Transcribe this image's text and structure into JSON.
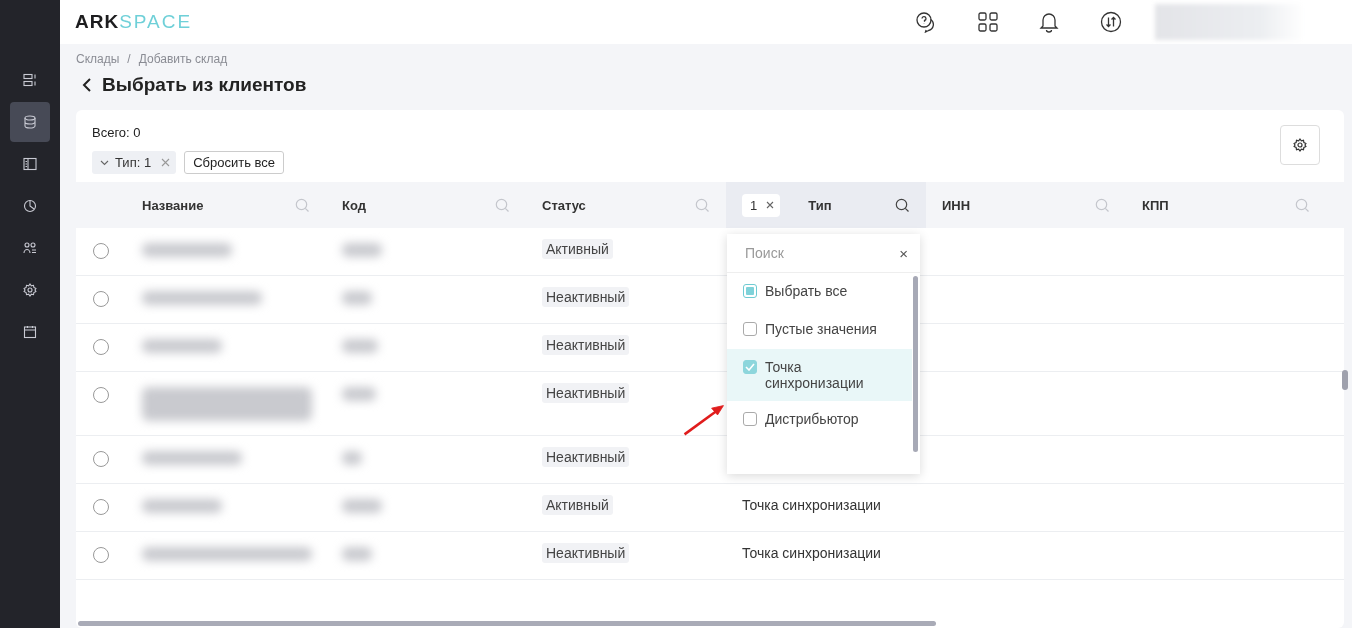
{
  "logo": {
    "dark": "ARK",
    "light": "SPACE"
  },
  "sidebar": {
    "items": [
      {
        "selected": false
      },
      {
        "selected": true
      },
      {
        "selected": false
      },
      {
        "selected": false
      },
      {
        "selected": false
      },
      {
        "selected": false
      },
      {
        "selected": false
      }
    ]
  },
  "breadcrumbs": [
    "Склады",
    "/",
    "Добавить склад"
  ],
  "page_title": "Выбрать из клиентов",
  "total": "Всего: 0",
  "filter_chip": "Тип: 1",
  "reset_button": "Сбросить все",
  "table": {
    "columns": [
      {
        "label": "Название",
        "filtered": false
      },
      {
        "label": "Код",
        "filtered": false
      },
      {
        "label": "Статус",
        "filtered": false
      },
      {
        "label": "Тип",
        "filtered": true,
        "filter_count": "1"
      },
      {
        "label": "ИНН",
        "filtered": false
      },
      {
        "label": "КПП",
        "filtered": false
      }
    ],
    "rows": [
      {
        "selected": false,
        "status": "Активный"
      },
      {
        "selected": false,
        "status": "Неактивный"
      },
      {
        "selected": false,
        "status": "Неактивный"
      },
      {
        "selected": false,
        "status": "Неактивный"
      },
      {
        "selected": false,
        "status": "Неактивный"
      },
      {
        "selected": false,
        "status": "Активный",
        "type": "Точка синхронизации"
      },
      {
        "selected": false,
        "status": "Неактивный",
        "type": "Точка синхронизации"
      }
    ]
  },
  "dropdown": {
    "placeholder": "Поиск",
    "close": "×",
    "options": [
      {
        "label": "Выбрать все",
        "checked": false,
        "partial": true
      },
      {
        "label": "Пустые значения",
        "checked": false,
        "partial": false
      },
      {
        "label": "Точка синхронизации",
        "checked": true,
        "partial": false
      },
      {
        "label": "Дистрибьютор",
        "checked": false,
        "partial": false
      }
    ]
  }
}
